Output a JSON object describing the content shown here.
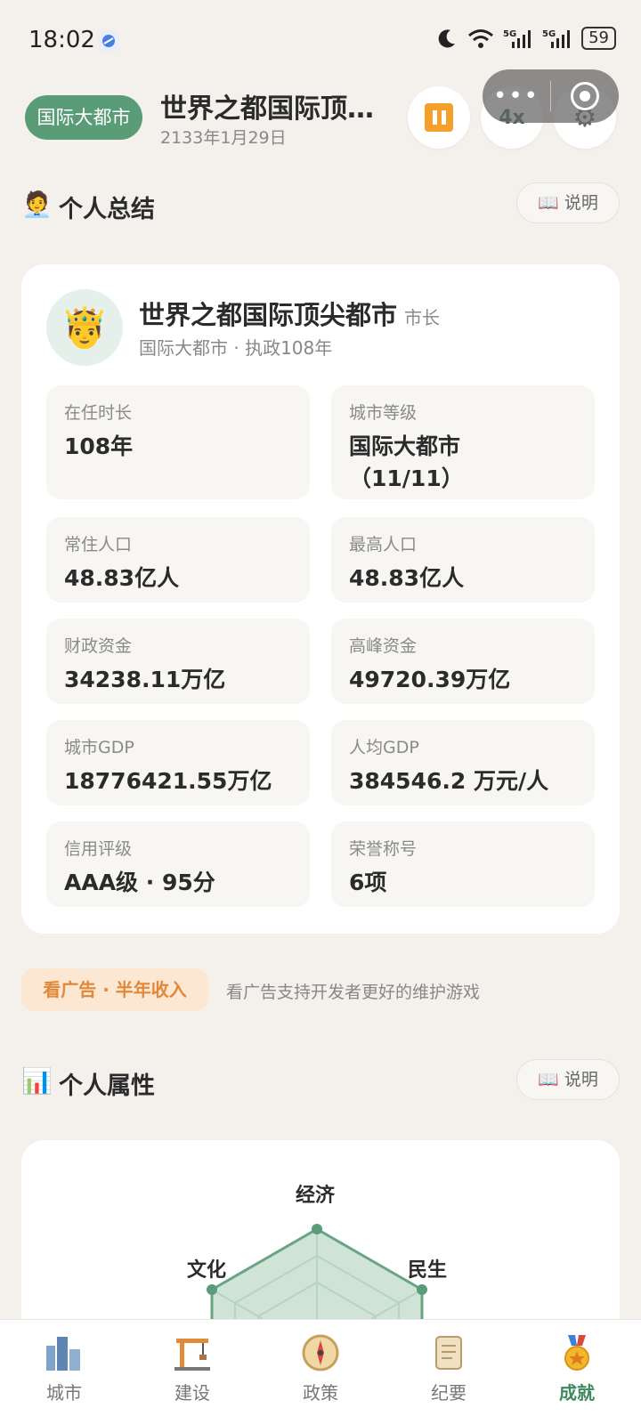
{
  "status_bar": {
    "time": "18:02",
    "battery": "59"
  },
  "header": {
    "level_badge": "国际大都市",
    "city_name": "世界之都国际顶…",
    "date": "2133年1月29日",
    "speed": "4x"
  },
  "summary": {
    "section_title": "个人总结",
    "explain_label": "📖 说明",
    "name": "世界之都国际顶尖都市",
    "role": "市长",
    "subtitle": "国际大都市 · 执政108年",
    "stats": [
      {
        "label": "在任时长",
        "value": "108年"
      },
      {
        "label": "城市等级",
        "value": "国际大都市（11/11）"
      },
      {
        "label": "常住人口",
        "value": "48.83亿人"
      },
      {
        "label": "最高人口",
        "value": "48.83亿人"
      },
      {
        "label": "财政资金",
        "value": "34238.11万亿"
      },
      {
        "label": "高峰资金",
        "value": "49720.39万亿"
      },
      {
        "label": "城市GDP",
        "value": "18776421.55万亿"
      },
      {
        "label": "人均GDP",
        "value": "384546.2 万元/人"
      },
      {
        "label": "信用评级",
        "value": "AAA级 · 95分"
      },
      {
        "label": "荣誉称号",
        "value": "6项"
      }
    ]
  },
  "ad": {
    "button_label": "看广告 · 半年收入",
    "text": "看广告支持开发者更好的维护游戏"
  },
  "attributes": {
    "section_title": "个人属性",
    "explain_label": "📖 说明",
    "axes": [
      "经济",
      "民生",
      "文化"
    ]
  },
  "bottom_nav": [
    {
      "label": "城市",
      "icon": "city-icon"
    },
    {
      "label": "建设",
      "icon": "crane-icon"
    },
    {
      "label": "政策",
      "icon": "compass-icon"
    },
    {
      "label": "纪要",
      "icon": "scroll-icon"
    },
    {
      "label": "成就",
      "icon": "medal-icon",
      "active": true
    }
  ],
  "colors": {
    "accent": "#5a9b78",
    "background": "#f4f1ec",
    "ad_accent": "#e2883a"
  }
}
